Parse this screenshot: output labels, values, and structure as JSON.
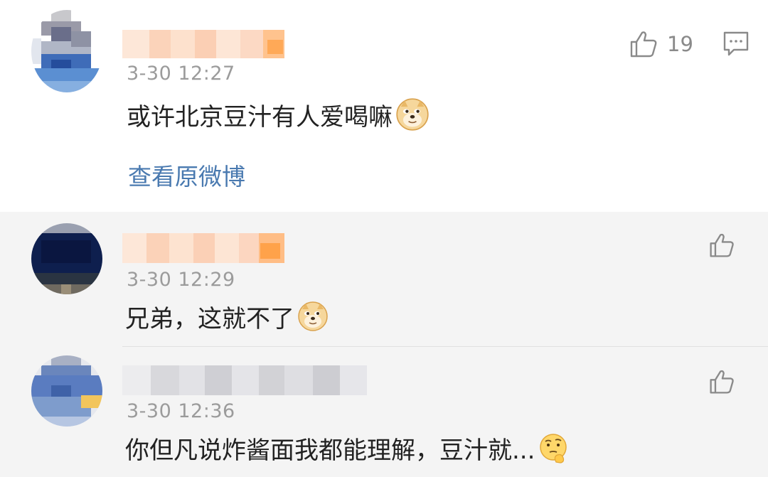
{
  "comment": {
    "time": "3-30 12:27",
    "text": "或许北京豆汁有人爱喝嘛",
    "emoji": "doge-emoji",
    "like_count": "19",
    "view_original": "查看原微博"
  },
  "replies": [
    {
      "time": "3-30 12:29",
      "text": "兄弟，这就不了",
      "emoji": "doge-emoji"
    },
    {
      "time": "3-30 12:36",
      "text": "你但凡说炸酱面我都能理解，豆汁就...",
      "emoji": "thinking-emoji"
    }
  ],
  "icons": {
    "like": "thumbs-up-icon",
    "comment": "comment-bubble-icon"
  },
  "colors": {
    "link": "#4a7ab0",
    "time": "#9b9b9b",
    "reply_bg": "#f4f4f4"
  }
}
